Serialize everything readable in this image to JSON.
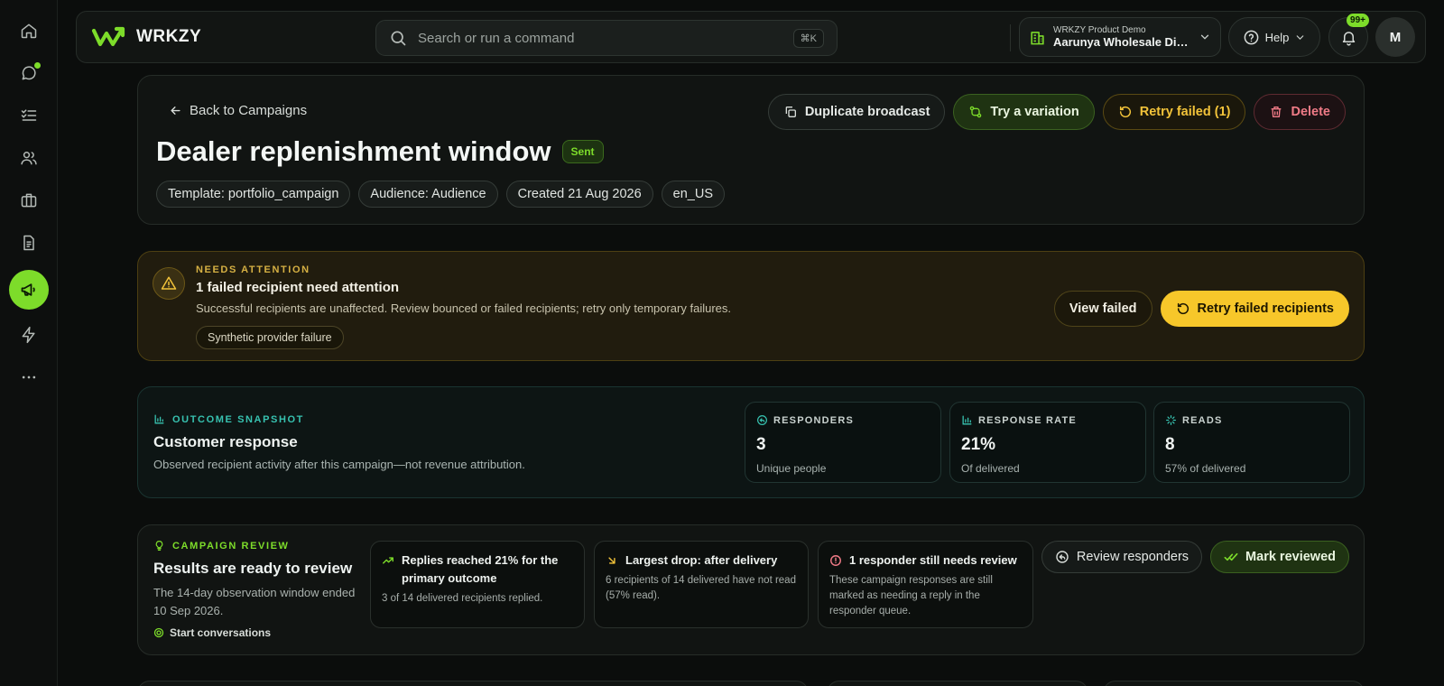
{
  "brand": {
    "name": "WRKZY",
    "accent": "#7ddc2a"
  },
  "sidebar": {
    "items": [
      {
        "icon": "home-icon",
        "label": "home"
      },
      {
        "icon": "chat-icon",
        "label": "conversations"
      },
      {
        "icon": "tasks-icon",
        "label": "tasks"
      },
      {
        "icon": "contacts-icon",
        "label": "contacts"
      },
      {
        "icon": "briefcase-icon",
        "label": "catalog"
      },
      {
        "icon": "document-icon",
        "label": "templates"
      },
      {
        "icon": "megaphone-icon",
        "label": "campaigns"
      },
      {
        "icon": "lightning-icon",
        "label": "automations"
      },
      {
        "icon": "more-icon",
        "label": "more"
      }
    ]
  },
  "header": {
    "search_placeholder": "Search or run a command",
    "search_shortcut": "⌘K",
    "workspace_sub": "WRKZY Product Demo",
    "workspace_name": "Aarunya Wholesale Distributors",
    "help_label": "Help",
    "notification_count": "99+",
    "avatar_initial": "M"
  },
  "campaign": {
    "back_label": "Back to Campaigns",
    "title": "Dealer replenishment window",
    "status": "Sent",
    "chips": [
      "Template: portfolio_campaign",
      "Audience: Audience",
      "Created 21 Aug 2026",
      "en_US"
    ],
    "actions": {
      "duplicate": "Duplicate broadcast",
      "variation": "Try a variation",
      "retry": "Retry failed (1)",
      "delete": "Delete"
    }
  },
  "attention": {
    "eyebrow": "NEEDS ATTENTION",
    "title": "1 failed recipient need attention",
    "description": "Successful recipients are unaffected. Review bounced or failed recipients; retry only temporary failures.",
    "tag": "Synthetic provider failure",
    "view_label": "View failed",
    "retry_label": "Retry failed recipients"
  },
  "outcome": {
    "eyebrow": "OUTCOME SNAPSHOT",
    "title": "Customer response",
    "description": "Observed recipient activity after this campaign—not revenue attribution.",
    "stats": [
      {
        "label": "RESPONDERS",
        "value": "3",
        "sub": "Unique people"
      },
      {
        "label": "RESPONSE RATE",
        "value": "21%",
        "sub": "Of delivered"
      },
      {
        "label": "READS",
        "value": "8",
        "sub": "57% of delivered"
      }
    ]
  },
  "review": {
    "eyebrow": "CAMPAIGN REVIEW",
    "title": "Results are ready to review",
    "description": "The 14-day observation window ended 10 Sep 2026.",
    "goal": "Start conversations",
    "insights": [
      {
        "title": "Replies reached 21% for the primary outcome",
        "body": "3 of 14 delivered recipients replied.",
        "color": "#7ddc2a"
      },
      {
        "title": "Largest drop: after delivery",
        "body": "6 recipients of 14 delivered have not read (57% read).",
        "color": "#f2c33a"
      },
      {
        "title": "1 responder still needs review",
        "body": "These campaign responses are still marked as needing a reply in the responder queue.",
        "color": "#f07b87"
      }
    ],
    "review_responders": "Review responders",
    "mark_reviewed": "Mark reviewed"
  }
}
